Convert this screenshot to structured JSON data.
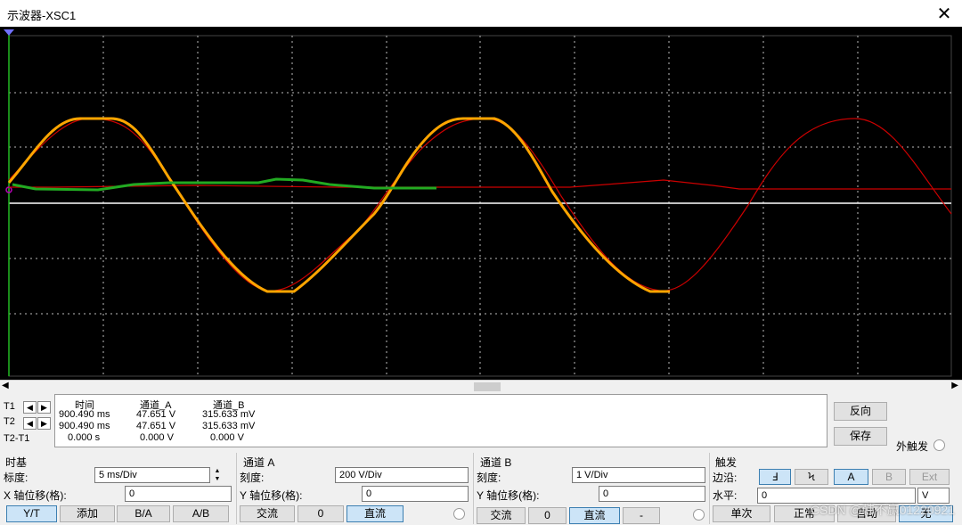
{
  "window": {
    "title": "示波器-XSC1",
    "close_glyph": "✕"
  },
  "colors": {
    "screen_bg": "#000000",
    "grid": "#ffffff",
    "channel_a": "#ff9900",
    "channel_b": "#cc0000",
    "reference": "#22aa22"
  },
  "cursors": {
    "rows": [
      "T1",
      "T2",
      "T2-T1"
    ],
    "headers": [
      "时间",
      "通道_A",
      "通道_B"
    ],
    "values": [
      [
        "900.490 ms",
        "47.651 V",
        "315.633 mV"
      ],
      [
        "900.490 ms",
        "47.651 V",
        "315.633 mV"
      ],
      [
        "0.000 s",
        "0.000 V",
        "0.000 V"
      ]
    ]
  },
  "right_buttons": {
    "reverse": "反向",
    "save": "保存",
    "ext_trigger": "外触发"
  },
  "timebase": {
    "title": "时基",
    "scale_label": "标度:",
    "scale_value": "5 ms/Div",
    "xpos_label": "X 轴位移(格):",
    "xpos_value": "0",
    "modes": [
      "Y/T",
      "添加",
      "B/A",
      "A/B"
    ]
  },
  "channel_a": {
    "title": "通道 A",
    "scale_label": "刻度:",
    "scale_value": "200  V/Div",
    "ypos_label": "Y 轴位移(格):",
    "ypos_value": "0",
    "coupling": [
      "交流",
      "0",
      "直流"
    ]
  },
  "channel_b": {
    "title": "通道 B",
    "scale_label": "刻度:",
    "scale_value": "1  V/Div",
    "ypos_label": "Y 轴位移(格):",
    "ypos_value": "0",
    "coupling": [
      "交流",
      "0",
      "直流",
      "-"
    ]
  },
  "trigger": {
    "title": "触发",
    "edge_label": "边沿:",
    "edge_buttons": [
      "Ⅎ",
      "Ϟ"
    ],
    "sources": [
      "A",
      "B",
      "Ext"
    ],
    "level_label": "水平:",
    "level_value": "0",
    "level_unit": "V",
    "modes": [
      "单次",
      "正常",
      "自动",
      "无"
    ]
  },
  "watermark": "CSDN @韩不赢01220921"
}
